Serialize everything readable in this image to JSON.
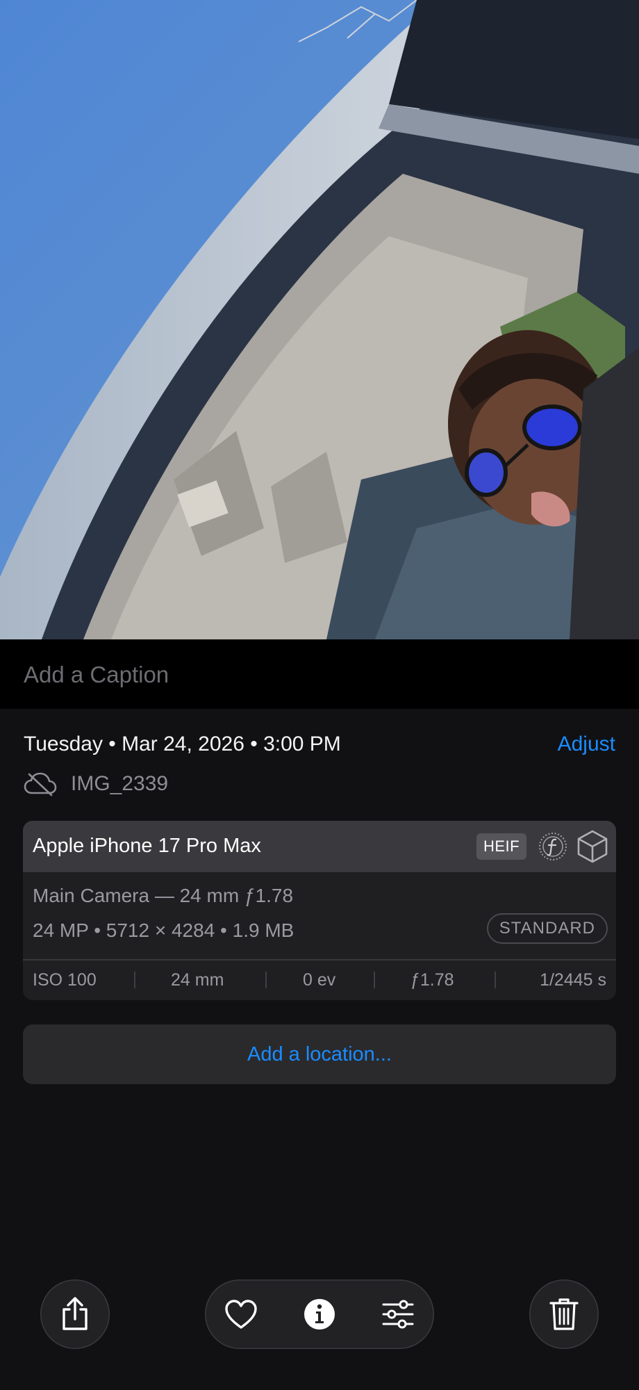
{
  "caption": {
    "placeholder": "Add a Caption"
  },
  "meta": {
    "date": "Tuesday • Mar 24, 2026 • 3:00 PM",
    "adjust_label": "Adjust",
    "file_name": "IMG_2339"
  },
  "camera": {
    "device": "Apple iPhone 17 Pro Max",
    "format": "HEIF",
    "lens": "Main Camera — 24 mm ƒ1.78",
    "specs": "24 MP • 5712 × 4284 • 1.9 MB",
    "style_badge": "STANDARD",
    "exif": [
      "ISO 100",
      "24 mm",
      "0 ev",
      "ƒ1.78",
      "1/2445 s"
    ]
  },
  "location": {
    "label": "Add a location..."
  },
  "icons": {
    "cloud": "cloud-off-icon",
    "f_stop": "aperture-f-icon",
    "cube": "cube-icon",
    "share": "share-icon",
    "heart": "heart-icon",
    "info": "info-icon",
    "sliders": "sliders-icon",
    "trash": "trash-icon"
  },
  "colors": {
    "accent": "#1a8cff",
    "background": "#111113",
    "card": "#1f1f22",
    "card_header": "#3a3a3e"
  }
}
